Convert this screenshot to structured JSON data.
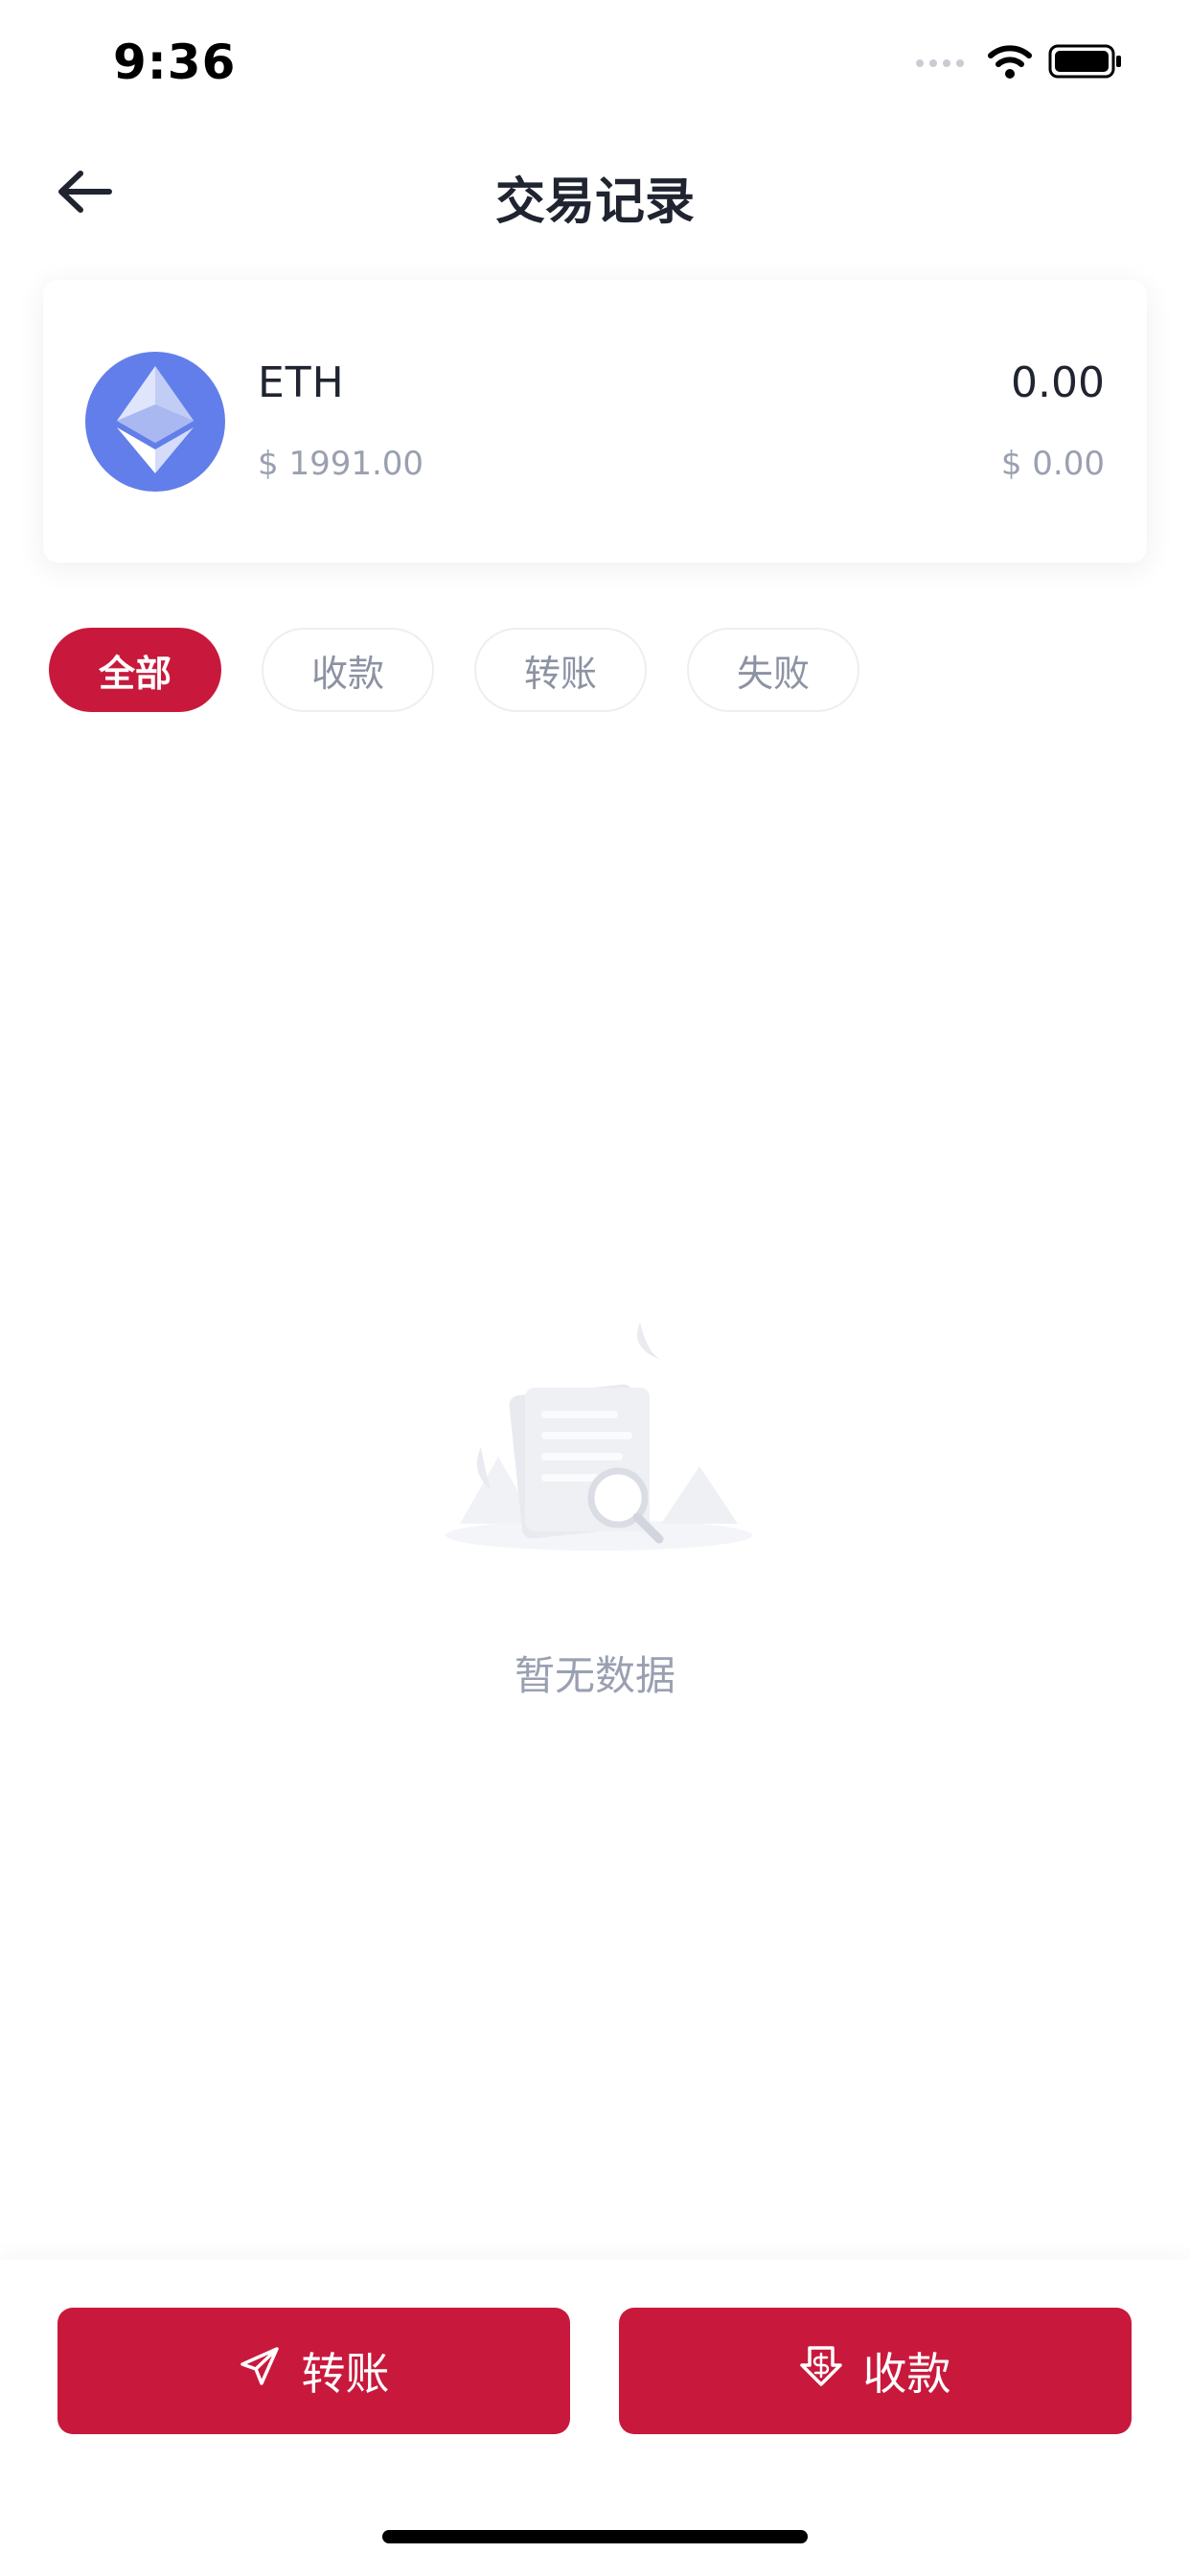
{
  "status_bar": {
    "time": "9:36"
  },
  "nav": {
    "title": "交易记录"
  },
  "asset": {
    "name": "ETH",
    "price": "$ 1991.00",
    "balance": "0.00",
    "value": "$ 0.00",
    "brand_color": "#627EEA"
  },
  "filters": [
    {
      "label": "全部",
      "active": true
    },
    {
      "label": "收款",
      "active": false
    },
    {
      "label": "转账",
      "active": false
    },
    {
      "label": "失败",
      "active": false
    }
  ],
  "empty_state": {
    "text": "暂无数据",
    "icon": "document-search-icon"
  },
  "actions": {
    "transfer_label": "转账",
    "receive_label": "收款",
    "accent_color": "#c8193c"
  }
}
